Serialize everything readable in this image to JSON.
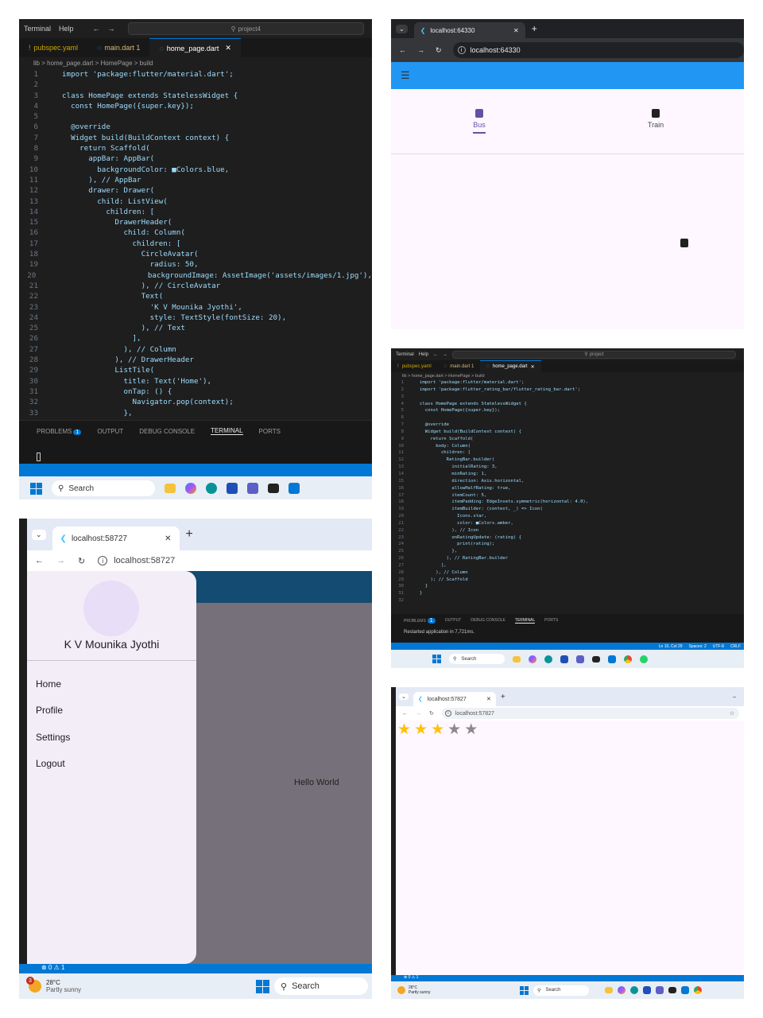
{
  "vscode_main": {
    "menu": [
      "Terminal",
      "Help"
    ],
    "search": "project4",
    "tabs": [
      {
        "label": "pubspec.yaml"
      },
      {
        "label": "main.dart 1"
      },
      {
        "label": "home_page.dart"
      }
    ],
    "breadcrumb": "lib > home_page.dart > HomePage > build",
    "code": [
      {
        "n": "1",
        "t": "import 'package:flutter/material.dart';"
      },
      {
        "n": "2",
        "t": ""
      },
      {
        "n": "3",
        "t": "class HomePage extends StatelessWidget {"
      },
      {
        "n": "4",
        "t": "  const HomePage({super.key});"
      },
      {
        "n": "5",
        "t": ""
      },
      {
        "n": "6",
        "t": "  @override"
      },
      {
        "n": "7",
        "t": "  Widget build(BuildContext context) {"
      },
      {
        "n": "8",
        "t": "    return Scaffold("
      },
      {
        "n": "9",
        "t": "      appBar: AppBar("
      },
      {
        "n": "10",
        "t": "        backgroundColor: ■Colors.blue,"
      },
      {
        "n": "11",
        "t": "      ), // AppBar"
      },
      {
        "n": "12",
        "t": "      drawer: Drawer("
      },
      {
        "n": "13",
        "t": "        child: ListView("
      },
      {
        "n": "14",
        "t": "          children: ["
      },
      {
        "n": "15",
        "t": "            DrawerHeader("
      },
      {
        "n": "16",
        "t": "              child: Column("
      },
      {
        "n": "17",
        "t": "                children: ["
      },
      {
        "n": "18",
        "t": "                  CircleAvatar("
      },
      {
        "n": "19",
        "t": "                    radius: 50,"
      },
      {
        "n": "20",
        "t": "                    backgroundImage: AssetImage('assets/images/1.jpg'),"
      },
      {
        "n": "21",
        "t": "                  ), // CircleAvatar"
      },
      {
        "n": "22",
        "t": "                  Text("
      },
      {
        "n": "23",
        "t": "                    'K V Mounika Jyothi',"
      },
      {
        "n": "24",
        "t": "                    style: TextStyle(fontSize: 20),"
      },
      {
        "n": "25",
        "t": "                  ), // Text"
      },
      {
        "n": "26",
        "t": "                ],"
      },
      {
        "n": "27",
        "t": "              ), // Column"
      },
      {
        "n": "28",
        "t": "            ), // DrawerHeader"
      },
      {
        "n": "29",
        "t": "            ListTile("
      },
      {
        "n": "30",
        "t": "              title: Text('Home'),"
      },
      {
        "n": "31",
        "t": "              onTap: () {"
      },
      {
        "n": "32",
        "t": "                Navigator.pop(context);"
      },
      {
        "n": "33",
        "t": "              },"
      }
    ],
    "panel_tabs": [
      "PROBLEMS",
      "OUTPUT",
      "DEBUG CONSOLE",
      "TERMINAL",
      "PORTS"
    ],
    "problems_count": "1",
    "taskbar_search": "Search"
  },
  "browser_tabs": {
    "tab_title": "localhost:64330",
    "url": "localhost:64330",
    "nav": [
      {
        "label": "Bus"
      },
      {
        "label": "Train"
      }
    ]
  },
  "vscode_rating": {
    "menu": [
      "Terminal",
      "Help"
    ],
    "search": "project",
    "tabs": [
      {
        "label": "pubspec.yaml"
      },
      {
        "label": "main.dart 1"
      },
      {
        "label": "home_page.dart"
      }
    ],
    "breadcrumb": "lib > home_page.dart > HomePage > build",
    "code": [
      {
        "n": "1",
        "t": "import 'package:flutter/material.dart';"
      },
      {
        "n": "2",
        "t": "import 'package:flutter_rating_bar/flutter_rating_bar.dart';"
      },
      {
        "n": "3",
        "t": ""
      },
      {
        "n": "4",
        "t": "class HomePage extends StatelessWidget {"
      },
      {
        "n": "5",
        "t": "  const HomePage({super.key});"
      },
      {
        "n": "6",
        "t": ""
      },
      {
        "n": "7",
        "t": "  @override"
      },
      {
        "n": "8",
        "t": "  Widget build(BuildContext context) {"
      },
      {
        "n": "9",
        "t": "    return Scaffold("
      },
      {
        "n": "10",
        "t": "      body: Column("
      },
      {
        "n": "11",
        "t": "        children: ["
      },
      {
        "n": "12",
        "t": "          RatingBar.builder("
      },
      {
        "n": "13",
        "t": "            initialRating: 3,"
      },
      {
        "n": "14",
        "t": "            minRating: 1,"
      },
      {
        "n": "15",
        "t": "            direction: Axis.horizontal,"
      },
      {
        "n": "16",
        "t": "            allowHalfRating: true,"
      },
      {
        "n": "17",
        "t": "            itemCount: 5,"
      },
      {
        "n": "18",
        "t": "            itemPadding: EdgeInsets.symmetric(horizontal: 4.0),"
      },
      {
        "n": "19",
        "t": "            itemBuilder: (context, _) => Icon("
      },
      {
        "n": "20",
        "t": "              Icons.star,"
      },
      {
        "n": "21",
        "t": "              color: ■Colors.amber,"
      },
      {
        "n": "22",
        "t": "            ), // Icon"
      },
      {
        "n": "23",
        "t": "            onRatingUpdate: (rating) {"
      },
      {
        "n": "24",
        "t": "              print(rating);"
      },
      {
        "n": "25",
        "t": "            },"
      },
      {
        "n": "26",
        "t": "          ), // RatingBar.builder"
      },
      {
        "n": "27",
        "t": "        ],"
      },
      {
        "n": "28",
        "t": "      ), // Column"
      },
      {
        "n": "29",
        "t": "    ); // Scaffold"
      },
      {
        "n": "30",
        "t": "  }"
      },
      {
        "n": "31",
        "t": "}"
      },
      {
        "n": "32",
        "t": ""
      }
    ],
    "panel_tabs": [
      "PROBLEMS",
      "OUTPUT",
      "DEBUG CONSOLE",
      "TERMINAL",
      "PORTS"
    ],
    "problems_count": "1",
    "terminal_output": "Restarted application in 7,721ms.",
    "status_right": [
      "Ln 10, Col 29",
      "Spaces: 2",
      "UTF-8",
      "CRLF"
    ],
    "taskbar_search": "Search"
  },
  "browser_drawer": {
    "tab_title": "localhost:58727",
    "url": "localhost:58727",
    "drawer_name": "K V Mounika Jyothi",
    "menu": [
      {
        "label": "Home"
      },
      {
        "label": "Profile"
      },
      {
        "label": "Settings"
      },
      {
        "label": "Logout"
      }
    ],
    "body_text": "Hello World",
    "weather_temp": "28°C",
    "weather_desc": "Partly sunny",
    "taskbar_search": "Search",
    "notif_count": "3"
  },
  "browser_rating": {
    "tab_title": "localhost:57827",
    "url": "localhost:57827",
    "rating": 3,
    "max_rating": 5,
    "weather_temp": "28°C",
    "weather_desc": "Partly sunny",
    "taskbar_search": "Search"
  },
  "colors": {
    "flutter_blue": "#2196f3",
    "drawer_bg": "#f3edf7",
    "scrim": "#75707a",
    "amber": "#ffc107",
    "vscode_blue": "#0078d4"
  }
}
